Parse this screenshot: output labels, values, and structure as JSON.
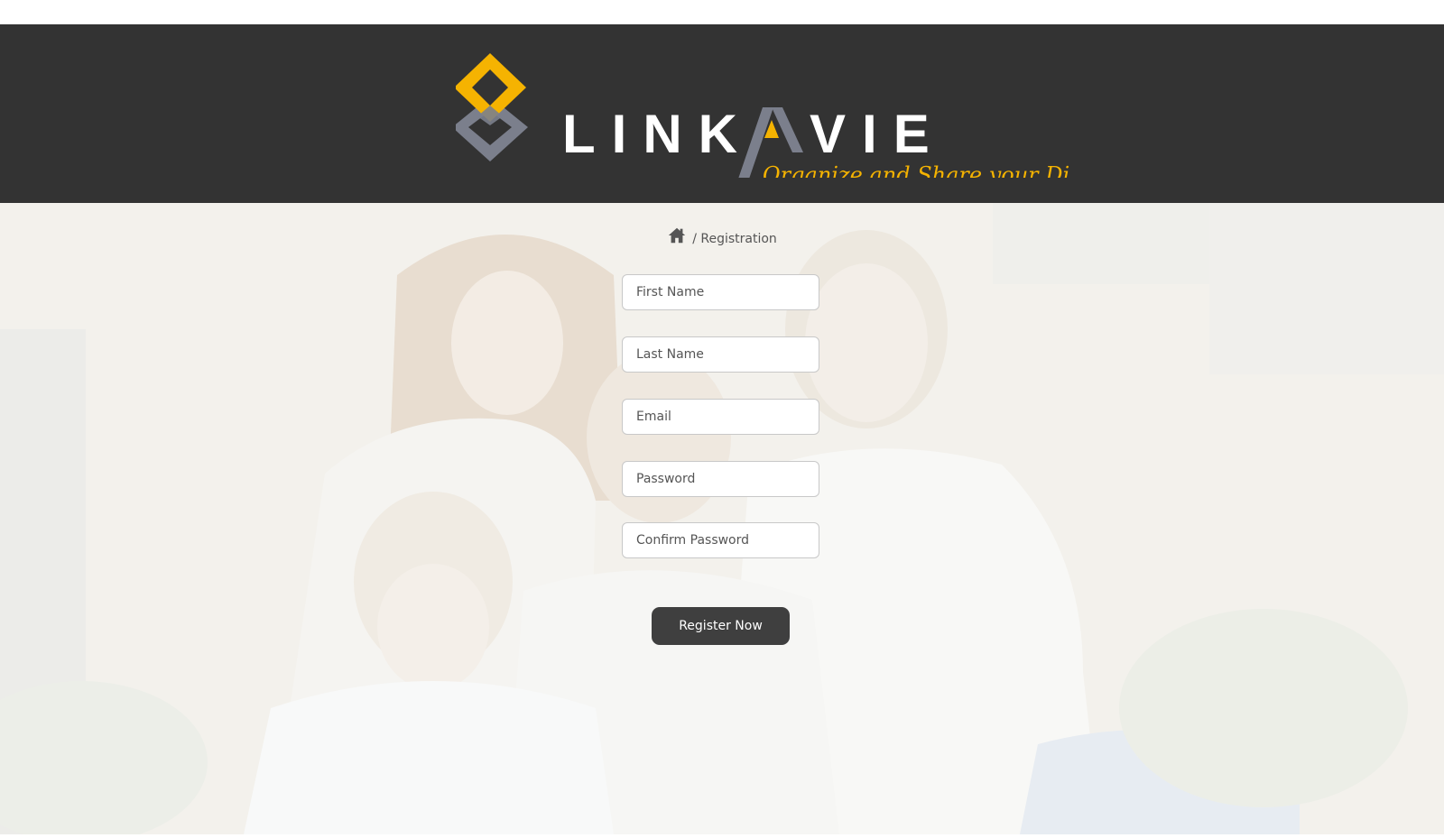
{
  "brand": {
    "name": "LINKAVIE",
    "tagline": "Organize and Share your Digital Life",
    "accent_color": "#f5b301",
    "secondary_color": "#7b7f8c",
    "header_bg": "#333333"
  },
  "breadcrumb": {
    "home_icon": "home-icon",
    "separator": "/",
    "current": "Registration"
  },
  "form": {
    "first_name": {
      "placeholder": "First Name",
      "value": ""
    },
    "last_name": {
      "placeholder": "Last Name",
      "value": ""
    },
    "email": {
      "placeholder": "Email",
      "value": ""
    },
    "password": {
      "placeholder": "Password",
      "value": ""
    },
    "confirm_password": {
      "placeholder": "Confirm Password",
      "value": ""
    },
    "submit_label": "Register Now"
  }
}
